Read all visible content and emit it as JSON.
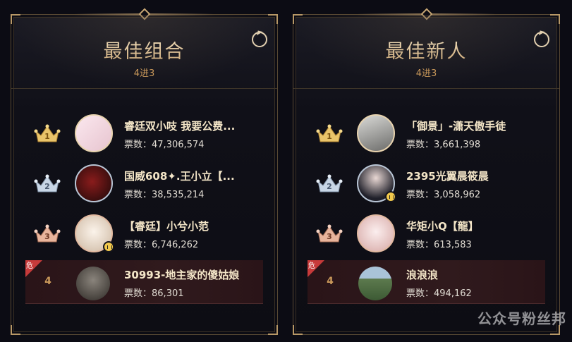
{
  "panels": [
    {
      "title": "最佳组合",
      "subtitle": "4进3",
      "entries": [
        {
          "rank": "1",
          "name": "睿廷双小吱 我要公费...",
          "votes_label": "票数：",
          "votes": "47,306,574",
          "crown": "gold",
          "avatar_color": "#f1d9e0"
        },
        {
          "rank": "2",
          "name": "国威608✦.王小立【...",
          "votes_label": "票数：",
          "votes": "38,535,214",
          "crown": "silver",
          "avatar_color": "#3a1212"
        },
        {
          "rank": "3",
          "name": "【睿廷】小兮小范",
          "votes_label": "票数：",
          "votes": "6,746,262",
          "crown": "bronze",
          "avatar_color": "#e9ded2"
        },
        {
          "rank": "4",
          "name": "30993-地主家的傻姑娘",
          "votes_label": "票数：",
          "votes": "86,301",
          "danger_label": "危",
          "avatar_color": "#5a554f"
        }
      ]
    },
    {
      "title": "最佳新人",
      "subtitle": "4进3",
      "entries": [
        {
          "rank": "1",
          "name": "「御景」-潇天傲手徒",
          "votes_label": "票数：",
          "votes": "3,661,398",
          "crown": "gold",
          "avatar_color": "#9a9a98"
        },
        {
          "rank": "2",
          "name": "2395光翼晨筱晨",
          "votes_label": "票数：",
          "votes": "3,058,962",
          "crown": "silver",
          "avatar_color": "#2a2a30"
        },
        {
          "rank": "3",
          "name": "华矩小Q【龍】",
          "votes_label": "票数：",
          "votes": "613,583",
          "crown": "bronze",
          "avatar_color": "#f3e2e0"
        },
        {
          "rank": "4",
          "name": "浪浪浪",
          "votes_label": "票数：",
          "votes": "494,162",
          "danger_label": "危",
          "avatar_color": "#5f7a58"
        }
      ]
    }
  ],
  "watermarks": {
    "main": "公众号粉丝邦"
  },
  "colors": {
    "gold": "#e9c46a",
    "silver": "#c8d6e6",
    "bronze": "#e8b49c",
    "danger": "#c73a3a"
  }
}
